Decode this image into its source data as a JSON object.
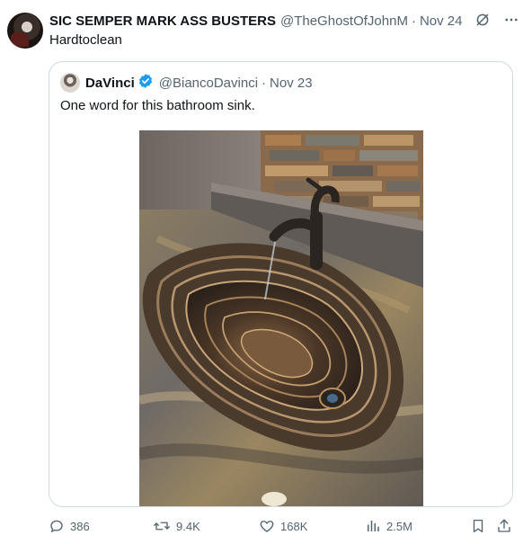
{
  "post": {
    "author_name": "SIC SEMPER MARK ASS BUSTERS",
    "author_handle": "@TheGhostOfJohnM",
    "separator": "·",
    "date": "Nov 24",
    "text": "Hardtoclean"
  },
  "quoted_post": {
    "author_name": "DaVinci",
    "author_handle": "@BiancoDavinci",
    "separator": "·",
    "date": "Nov 23",
    "text": "One word for this bathroom sink.",
    "verified_color": "#1d9bf0"
  },
  "actions": {
    "replies": "386",
    "reposts": "9.4K",
    "likes": "168K",
    "views": "2.5M"
  },
  "icons": {
    "header": [
      "grok-icon",
      "more-icon"
    ],
    "actions": [
      "reply-icon",
      "repost-icon",
      "like-icon",
      "views-icon",
      "bookmark-icon",
      "share-icon"
    ]
  },
  "colors": {
    "text_primary": "#0f1419",
    "text_secondary": "#536471",
    "border": "#cfd9de",
    "accent": "#1d9bf0"
  }
}
